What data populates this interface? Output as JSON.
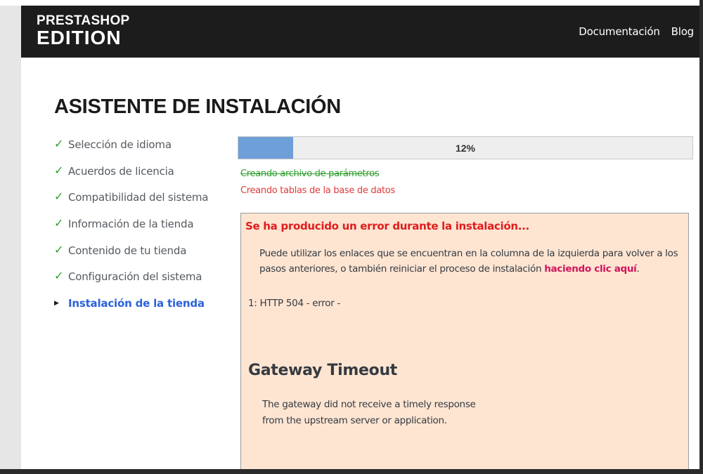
{
  "header": {
    "logo_line1": "PRESTASHOP",
    "logo_line2": "EDITION",
    "nav": {
      "docs": "Documentación",
      "blog": "Blog"
    },
    "colors": {
      "background": "#1c1c1c",
      "text": "#ffffff"
    }
  },
  "page_title": "ASISTENTE DE INSTALACIÓN",
  "steps": [
    {
      "label": "Selección de idioma",
      "status": "done",
      "marker": "✓"
    },
    {
      "label": "Acuerdos de licencia",
      "status": "done",
      "marker": "✓"
    },
    {
      "label": "Compatibilidad del sistema",
      "status": "done",
      "marker": "✓"
    },
    {
      "label": "Información de la tienda",
      "status": "done",
      "marker": "✓"
    },
    {
      "label": "Contenido de tu tienda",
      "status": "done",
      "marker": "✓"
    },
    {
      "label": "Configuración del sistema",
      "status": "done",
      "marker": "✓"
    },
    {
      "label": "Instalación de la tienda",
      "status": "current",
      "marker": "▶"
    }
  ],
  "progress": {
    "percent": 12,
    "label": "12%",
    "fill_color": "#6f9fd8"
  },
  "log": {
    "done": "Creando archivo de parámetros",
    "active": "Creando tablas de la base de datos"
  },
  "error": {
    "title": "Se ha producido un error durante la instalación...",
    "message_prefix": "Puede utilizar los enlaces que se encuentran en la columna de la izquierda para volver a los pasos anteriores, o también reiniciar el proceso de instalación ",
    "restart_link": "haciendo clic aquí",
    "message_suffix": ".",
    "code": "1: HTTP 504 - error -",
    "gateway_title": "Gateway Timeout",
    "gateway_line1": "The gateway did not receive a timely response",
    "gateway_line2": "from the upstream server or application.",
    "colors": {
      "background": "#fde5d2",
      "title": "#e01d1d",
      "link": "#d0145c"
    }
  }
}
